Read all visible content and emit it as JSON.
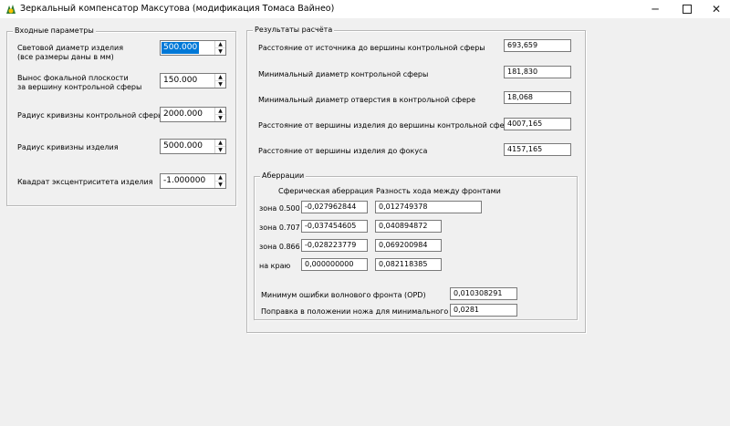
{
  "window": {
    "title": "Зеркальный компенсатор Максутова (модификация Томаса Вайнео)",
    "controls": {
      "minimize": "─",
      "close": "✕"
    },
    "icon": "app-icon"
  },
  "inputs": {
    "legend": "Входные параметры",
    "fields": [
      {
        "label_line1": "Световой диаметр изделия",
        "label_line2": "(все размеры даны в мм)",
        "value": "500.000"
      },
      {
        "label_line1": "Вынос фокальной плоскости",
        "label_line2": "за вершину контрольной сферы",
        "value": "150.000"
      },
      {
        "label_line1": "Радиус кривизны контрольной сферы",
        "value": "2000.000"
      },
      {
        "label_line1": "Радиус кривизны изделия",
        "value": "5000.000"
      },
      {
        "label_line1": "Квадрат эксцентриситета изделия",
        "value": "-1.000000"
      }
    ]
  },
  "results": {
    "legend": "Результаты расчёта",
    "rows": [
      {
        "label": "Расстояние от источника до вершины контрольной сферы",
        "value": "693,659"
      },
      {
        "label": "Минимальный диаметр контрольной сферы",
        "value": "181,830"
      },
      {
        "label": "Минимальный диаметр отверстия в контрольной сфере",
        "value": "18,068"
      },
      {
        "label": "Расстояние от вершины изделия до вершины контрольной сферы",
        "value": "4007,165"
      },
      {
        "label": "Расстояние от вершины изделия до фокуса",
        "value": "4157,165"
      }
    ]
  },
  "aberrations": {
    "legend": "Аберрации",
    "col_spherical": "Сферическая аберрация",
    "col_path": "Разность хода между фронтами",
    "rows": [
      {
        "zone": "зона 0.500",
        "spherical": "-0,027962844",
        "path": "0,012749378"
      },
      {
        "zone": "зона 0.707",
        "spherical": "-0,037454605",
        "path": "0,040894872"
      },
      {
        "zone": "зона 0.866",
        "spherical": "-0,028223779",
        "path": "0,069200984"
      },
      {
        "zone": "на краю",
        "spherical": "0,000000000",
        "path": "0,082118385"
      }
    ],
    "opd_label": "Минимум ошибки волнового фронта (OPD)",
    "opd_value": "0,010308291",
    "knife_label": "Поправка в положении ножа для минимального OPD",
    "knife_value": "0,0281"
  }
}
